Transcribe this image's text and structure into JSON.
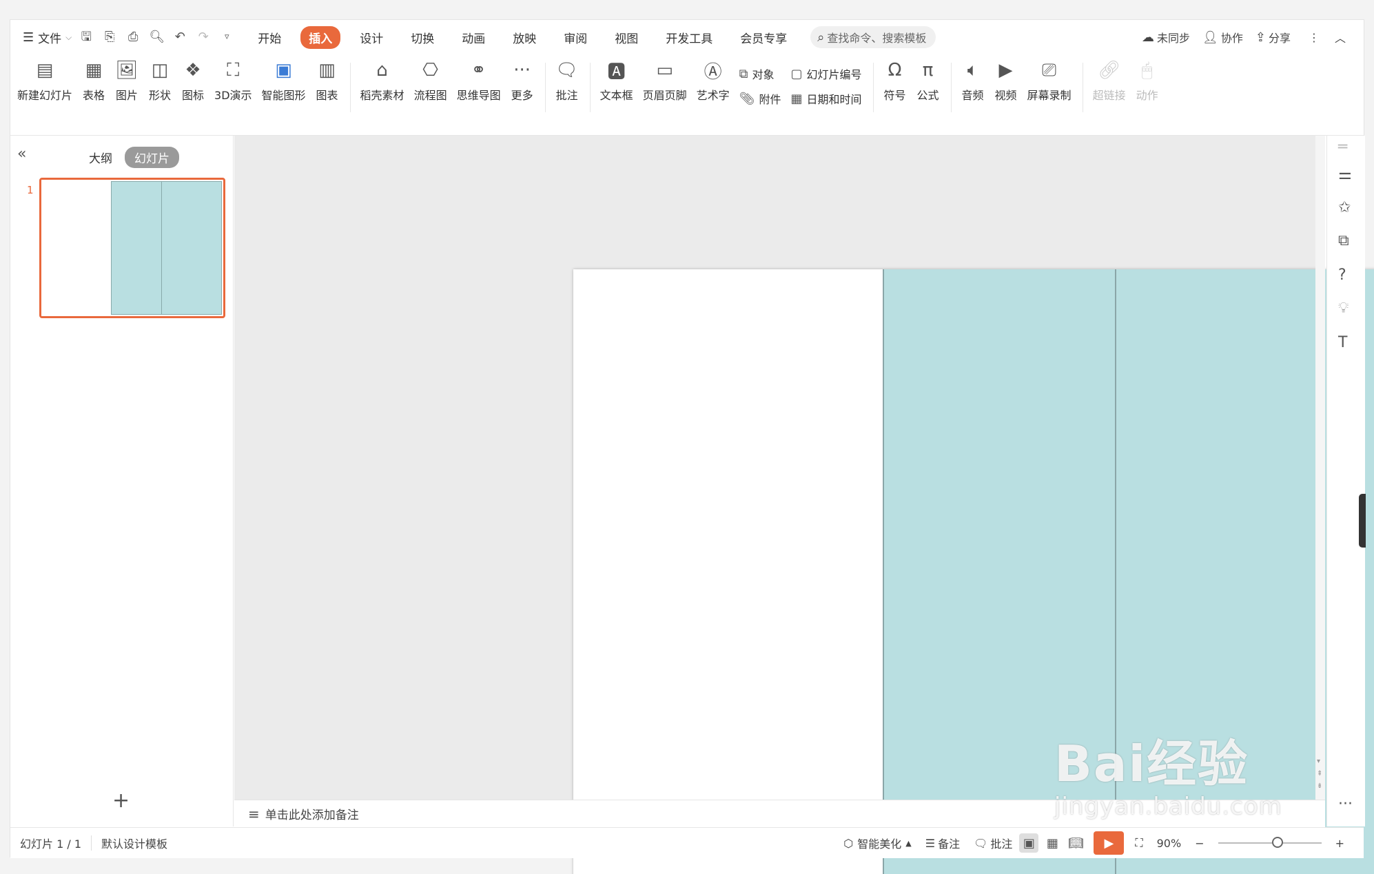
{
  "menubar": {
    "file": "文件",
    "tabs": [
      "开始",
      "插入",
      "设计",
      "切换",
      "动画",
      "放映",
      "审阅",
      "视图",
      "开发工具",
      "会员专享"
    ],
    "active_tab": "插入",
    "search_placeholder": "查找命令、搜索模板",
    "right": {
      "sync": "未同步",
      "collab": "协作",
      "share": "分享"
    }
  },
  "ribbon": {
    "new_slide": "新建幻灯片",
    "table": "表格",
    "picture": "图片",
    "shape": "形状",
    "icon": "图标",
    "demo3d": "3D演示",
    "smartart": "智能图形",
    "chart": "图表",
    "daoke": "稻壳素材",
    "flowchart": "流程图",
    "mindmap": "思维导图",
    "more": "更多",
    "comment": "批注",
    "textbox": "文本框",
    "header_footer": "页眉页脚",
    "wordart": "艺术字",
    "object": "对象",
    "attachment": "附件",
    "slide_number": "幻灯片编号",
    "datetime": "日期和时间",
    "symbol": "符号",
    "formula": "公式",
    "audio": "音频",
    "video": "视频",
    "screen_record": "屏幕录制",
    "hyperlink": "超链接",
    "action": "动作"
  },
  "leftpanel": {
    "tab_outline": "大纲",
    "tab_slides": "幻灯片",
    "slide_number": "1"
  },
  "notes": {
    "placeholder": "单击此处添加备注"
  },
  "status": {
    "slide_info": "幻灯片 1 / 1",
    "template": "默认设计模板",
    "beautify": "智能美化",
    "notes": "备注",
    "comment": "批注",
    "zoom": "90%"
  },
  "watermark": {
    "brand": "Bai经验",
    "url": "jingyan.baidu.com"
  },
  "colors": {
    "accent": "#e9693c",
    "slide_panel": "#b9dfe1"
  }
}
